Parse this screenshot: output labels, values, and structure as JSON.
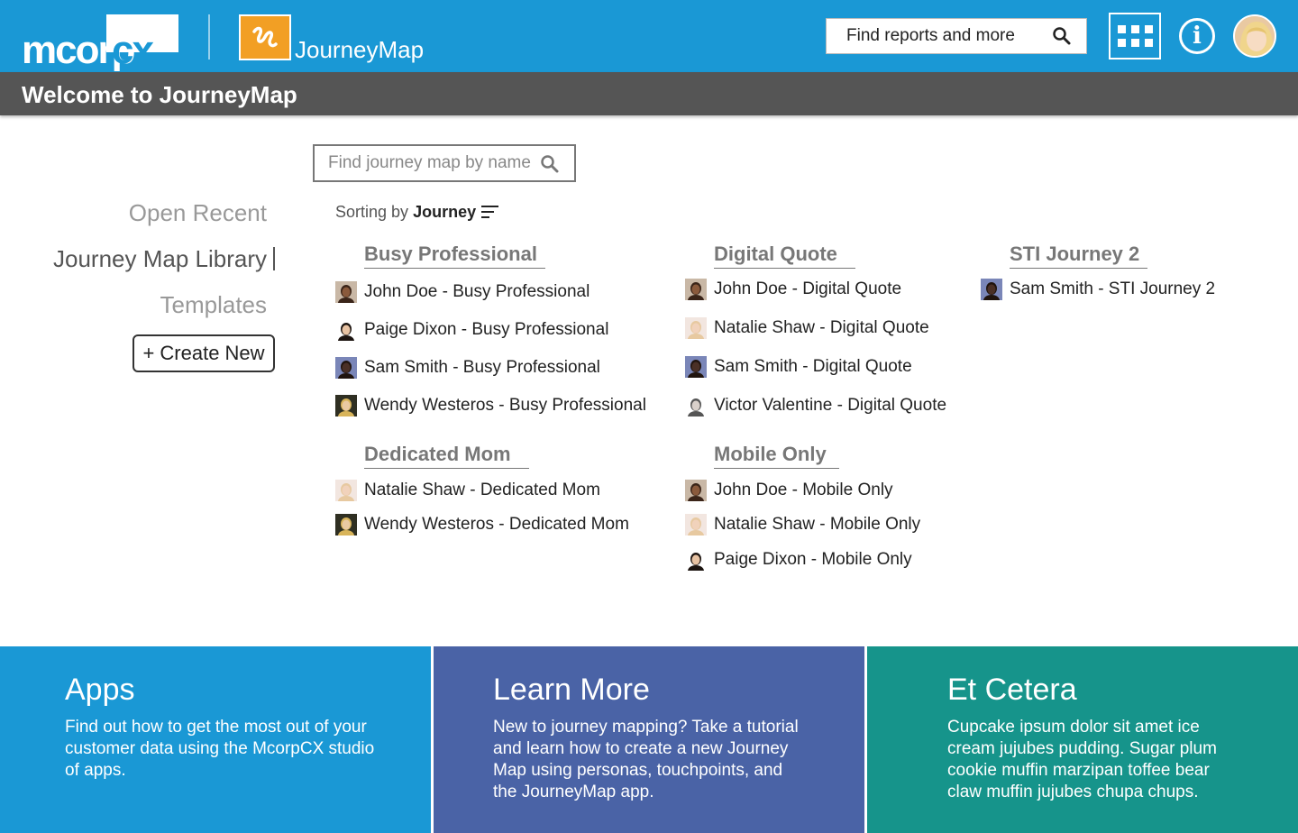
{
  "header": {
    "brand_prefix": "mcorp",
    "brand_suffix": "cx",
    "app_name": "JourneyMap",
    "search_placeholder": "Find reports and more",
    "info_symbol": "i",
    "colors": {
      "bar": "#1a98d5",
      "app_icon": "#f29f24"
    }
  },
  "welcome": {
    "title": "Welcome to JourneyMap"
  },
  "map_search": {
    "placeholder": "Find journey map by name"
  },
  "nav": {
    "items": [
      {
        "label": "Open Recent"
      },
      {
        "label": "Journey Map Library"
      },
      {
        "label": "Templates"
      }
    ],
    "create_label": "+ Create New"
  },
  "sorting": {
    "prefix": "Sorting by",
    "key": "Journey"
  },
  "groups": [
    {
      "title": "Busy Professional",
      "items": [
        {
          "label": "John Doe - Busy Professional",
          "avatar": "john"
        },
        {
          "label": "Paige Dixon - Busy Professional",
          "avatar": "paige"
        },
        {
          "label": "Sam Smith - Busy Professional",
          "avatar": "sam"
        },
        {
          "label": "Wendy Westeros - Busy Professional",
          "avatar": "wendy"
        }
      ]
    },
    {
      "title": "Digital Quote",
      "items": [
        {
          "label": "John Doe - Digital Quote",
          "avatar": "john"
        },
        {
          "label": "Natalie Shaw - Digital Quote",
          "avatar": "natalie"
        },
        {
          "label": "Sam Smith - Digital Quote",
          "avatar": "sam"
        },
        {
          "label": "Victor Valentine - Digital Quote",
          "avatar": "victor"
        }
      ]
    },
    {
      "title": "STI Journey 2",
      "items": [
        {
          "label": "Sam Smith - STI Journey 2",
          "avatar": "sam"
        }
      ]
    },
    {
      "title": "Dedicated Mom",
      "items": [
        {
          "label": "Natalie Shaw - Dedicated Mom",
          "avatar": "natalie"
        },
        {
          "label": "Wendy Westeros - Dedicated Mom",
          "avatar": "wendy"
        }
      ]
    },
    {
      "title": "Mobile Only",
      "items": [
        {
          "label": "John Doe - Mobile Only",
          "avatar": "john"
        },
        {
          "label": "Natalie Shaw - Mobile Only",
          "avatar": "natalie"
        },
        {
          "label": "Paige Dixon - Mobile Only",
          "avatar": "paige"
        }
      ]
    }
  ],
  "cards": [
    {
      "title": "Apps",
      "text": "Find out how to get the most out of your customer data using the McorpCX studio of apps.",
      "color": "#1a98d5"
    },
    {
      "title": "Learn More",
      "text": "New to journey mapping? Take a tutorial and learn how to create a new Journey Map using personas, touchpoints, and the JourneyMap app.",
      "color": "#4a63a6"
    },
    {
      "title": "Et Cetera",
      "text": "Cupcake ipsum dolor sit amet ice cream jujubes pudding. Sugar plum cookie muffin marzipan toffee bear claw muffin jujubes chupa chups.",
      "color": "#16948b"
    }
  ]
}
